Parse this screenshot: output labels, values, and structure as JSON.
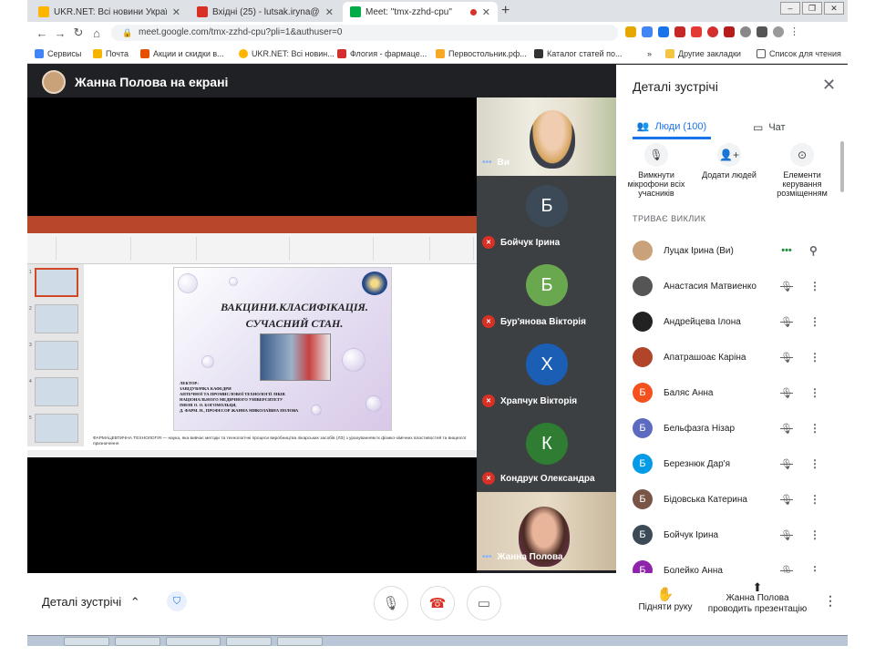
{
  "browser": {
    "tabs": [
      {
        "title": "UKR.NET: Всі новини України, ос",
        "fav": "#ffb400"
      },
      {
        "title": "Вхідні (25) - lutsak.iryna@pharm",
        "fav": "#d93025"
      },
      {
        "title": "Meet: \"tmx-zzhd-cpu\"",
        "fav": "#00ac47"
      }
    ],
    "url": "meet.google.com/tmx-zzhd-cpu?pli=1&authuser=0",
    "bookmarks": [
      "Сервисы",
      "Почта",
      "Акции и скидки в...",
      "UKR.NET: Всі новин...",
      "Флогия - фармаце...",
      "Первостольник.рф...",
      "Каталог статей по...",
      "»",
      "Другие закладки",
      "Список для чтения"
    ],
    "new_tab": "+",
    "win_buttons": [
      "–",
      "❐",
      "✕"
    ]
  },
  "presenter": {
    "label": "Жанна Полова на екрані"
  },
  "slide": {
    "title1": "ВАКЦИНИ.КЛАСИФІКАЦІЯ.",
    "title2": "СУЧАСНИЙ СТАН.",
    "lecturer": [
      "ЛЕКТОР:",
      "ЗАВІДУВАЧКА КАФЕДРИ",
      "АПТЕЧНОЇ ТА ПРОМИСЛОВОЇ ТЕХНОЛОГІЇ ЛІКІВ",
      "НАЦІОНАЛЬНОГО МЕДИЧНОГО УНІВЕРСИТЕТУ",
      "ІМЕНІ О. О. БОГОМОЛЬЦЯ,",
      "Д. ФАРМ. Н., ПРОФЕСОР ЖАННА МИКОЛАЇВНА ПОЛОВА"
    ],
    "notes": "ФАРМАЦЕВТИЧНА ТЕХНОЛОГІЯ — наука, яка вивчає методи та технологічні процеси виробництва лікарських засобів (ЛЗ) з урахуванням їх фізико-хімічних властивостей та вищезгої призначення",
    "thumb_numbers": [
      "1",
      "2",
      "3",
      "4",
      "5"
    ]
  },
  "tiles": [
    {
      "name": "Ви",
      "type": "camera"
    },
    {
      "name": "Бойчук Ірина",
      "letter": "Б",
      "color": "#3c4a57",
      "type": "avatar"
    },
    {
      "name": "Бур'янова Вікторія",
      "letter": "Б",
      "color": "#6aa84f",
      "type": "avatar"
    },
    {
      "name": "Храпчук Вікторія",
      "letter": "Х",
      "color": "#1a5fb4",
      "type": "avatar"
    },
    {
      "name": "Кондрук Олександра",
      "letter": "К",
      "color": "#2e7d32",
      "type": "avatar"
    },
    {
      "name": "Жанна Полова",
      "type": "camera"
    }
  ],
  "panel": {
    "title": "Деталі зустрічі",
    "tab_people": "Люди (100)",
    "tab_chat": "Чат",
    "controls": [
      {
        "label": "Вимкнути мікрофони всіх учасників",
        "icon": "mic-off-icon"
      },
      {
        "label": "Додати людей",
        "icon": "add-person-icon"
      },
      {
        "label": "Елементи керування розміщенням",
        "icon": "toggle-icon"
      }
    ],
    "in_call": "ТРИВАЄ ВИКЛИК",
    "people": [
      {
        "name": "Луцак Ірина (Ви)",
        "letter": "",
        "color": "#c9a27a",
        "state": "talking"
      },
      {
        "name": "Анастасия Матвиенко",
        "letter": "",
        "color": "#555555",
        "state": "muted"
      },
      {
        "name": "Андрейцева Ілона",
        "letter": "",
        "color": "#222222",
        "state": "muted"
      },
      {
        "name": "Апатрашоає Каріна",
        "letter": "",
        "color": "#b0452a",
        "state": "muted"
      },
      {
        "name": "Баляс Анна",
        "letter": "Б",
        "color": "#f4511e",
        "state": "muted"
      },
      {
        "name": "Бельфазга Нізар",
        "letter": "Б",
        "color": "#5c6bc0",
        "state": "muted"
      },
      {
        "name": "Березнюк Дар'я",
        "letter": "Б",
        "color": "#039be5",
        "state": "muted"
      },
      {
        "name": "Бідовська Катерина",
        "letter": "Б",
        "color": "#795548",
        "state": "muted"
      },
      {
        "name": "Бойчук Ірина",
        "letter": "Б",
        "color": "#3c4a57",
        "state": "muted"
      },
      {
        "name": "Болейко Анна",
        "letter": "Б",
        "color": "#8e24aa",
        "state": "muted"
      }
    ]
  },
  "bottom": {
    "details": "Деталі зустрічі",
    "raise_hand": "Підняти руку",
    "presenting": "Жанна Полова проводить презентацію"
  }
}
